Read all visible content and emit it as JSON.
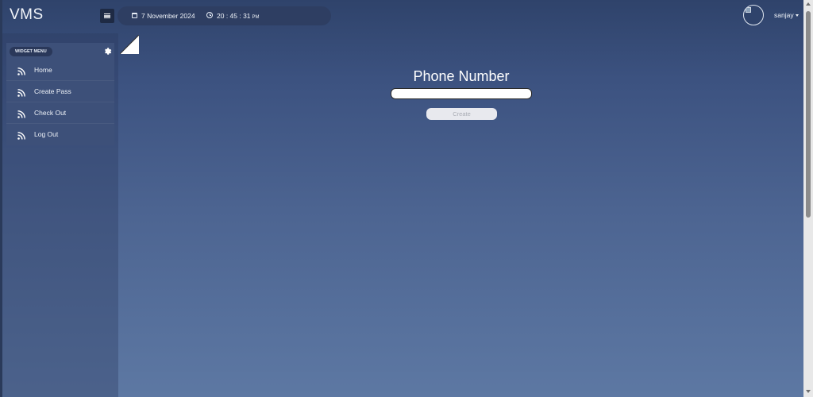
{
  "header": {
    "brand": "VMS",
    "date": "7 November 2024",
    "time": "20 : 45 : 31",
    "time_period": "PM",
    "user_name": "sanjay"
  },
  "sidebar": {
    "widget_menu_label": "WIDGET MENU",
    "items": [
      {
        "label": "Home",
        "icon": "rss-icon"
      },
      {
        "label": "Create Pass",
        "icon": "rss-icon"
      },
      {
        "label": "Check Out",
        "icon": "rss-icon"
      },
      {
        "label": "Log Out",
        "icon": "rss-icon"
      }
    ]
  },
  "form": {
    "title": "Phone Number",
    "input_value": "",
    "input_placeholder": "",
    "button_label": "Create"
  },
  "colors": {
    "background_top": "#2f436b",
    "background_bottom": "#5d78a3",
    "panel": "#3d5079",
    "button_disabled": "#e8e9ee"
  }
}
